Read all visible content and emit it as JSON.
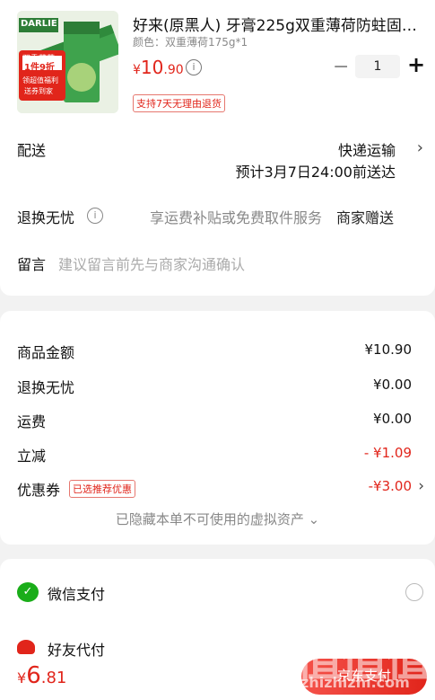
{
  "product": {
    "title": "好来(原黑人) 牙膏225g双重薄荷防蛀固齿…",
    "spec": "颜色：双重薄荷175g*1",
    "price_symbol": "¥",
    "price_int": "10",
    "price_dec": ".90",
    "quantity": "1",
    "return_tag": "支持7天无理由退货",
    "package_brand": "DARLIE",
    "package_promo_1": "双重薄荷",
    "package_promo_2": "1件9折",
    "package_promo_3": "领超值福利",
    "package_promo_4": "送券到家"
  },
  "delivery": {
    "label": "配送",
    "method": "快递运输",
    "eta": "预计3月7日24:00前送达"
  },
  "returns": {
    "label": "退换无忧",
    "description": "享运费补贴或免费取件服务",
    "gift": "商家赠送"
  },
  "message": {
    "label": "留言",
    "placeholder": "建议留言前先与商家沟通确认"
  },
  "summary": {
    "goods_label": "商品金额",
    "goods_value": "¥10.90",
    "returns_label": "退换无忧",
    "returns_value": "¥0.00",
    "shipping_label": "运费",
    "shipping_value": "¥0.00",
    "discount_label": "立减",
    "discount_value": "- ¥1.09",
    "coupon_label": "优惠券",
    "coupon_tag": "已选推荐优惠",
    "coupon_value": "-¥3.00",
    "hidden_note": "已隐藏本单不可使用的虚拟资产 ⌄"
  },
  "payment": {
    "wechat_label": "微信支付",
    "friend_label": "好友代付"
  },
  "footer": {
    "total_symbol": "¥",
    "total_int": "6",
    "total_dec": ".81",
    "pay_button": "京东支付"
  },
  "watermark": {
    "main": "值值值",
    "url": "zhizhizhi.com"
  },
  "colors": {
    "accent": "#e1251b",
    "wechat": "#1aad19"
  }
}
